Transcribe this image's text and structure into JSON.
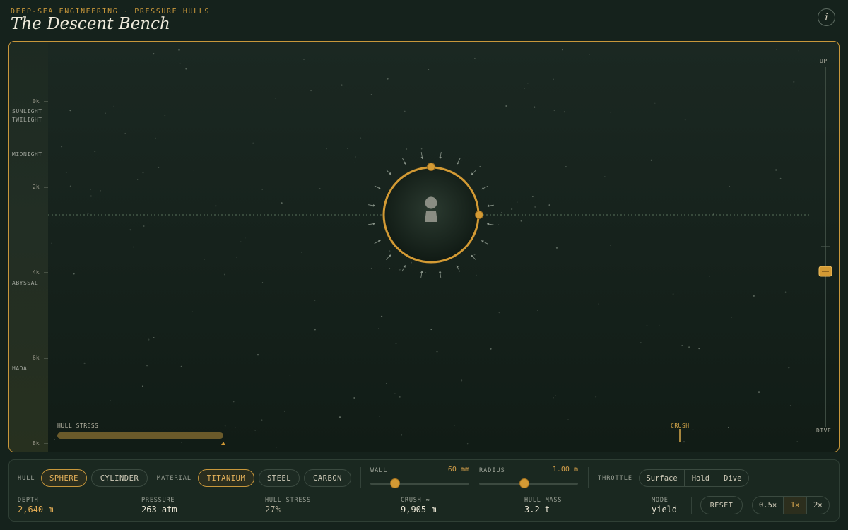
{
  "header": {
    "eyebrow": "DEEP-SEA ENGINEERING · PRESSURE HULLS",
    "title": "The Descent Bench",
    "info_icon": "info-icon"
  },
  "gauge": {
    "ticks": [
      "0k",
      "2k",
      "4k",
      "6k",
      "8k"
    ],
    "zones": [
      "SUNLIGHT",
      "TWILIGHT",
      "MIDNIGHT",
      "ABYSSAL",
      "HADAL"
    ],
    "current_depth_m": 2640,
    "max_depth_m": 8000
  },
  "throttle_slider": {
    "top_label": "UP",
    "bottom_label": "DIVE",
    "level": 0.48
  },
  "stage": {
    "hull_stress_label": "HULL STRESS",
    "hull_stress_fraction": 0.27,
    "crush_label": "CRUSH",
    "crush_depth_m": 9905
  },
  "controls": {
    "hull_label": "HULL",
    "hull_options": [
      "SPHERE",
      "CYLINDER"
    ],
    "hull_selected": "SPHERE",
    "material_label": "MATERIAL",
    "material_options": [
      "TITANIUM",
      "STEEL",
      "CARBON"
    ],
    "material_selected": "TITANIUM",
    "wall_label": "WALL",
    "wall_value": "60",
    "wall_unit": "mm",
    "wall_level": 0.25,
    "radius_label": "RADIUS",
    "radius_value": "1.00",
    "radius_unit": "m",
    "radius_level": 0.46,
    "throttle_label": "THROTTLE",
    "throttle_options": [
      "Surface",
      "Hold",
      "Dive"
    ]
  },
  "stats": {
    "depth_label": "DEPTH",
    "depth_value": "2,640 m",
    "pressure_label": "PRESSURE",
    "pressure_value": "263 atm",
    "hull_stress_label": "HULL STRESS",
    "hull_stress_value": "27%",
    "crush_label": "CRUSH ≈",
    "crush_value": "9,905 m",
    "hull_mass_label": "HULL MASS",
    "hull_mass_value": "3.2 t",
    "mode_label": "MODE",
    "mode_value": "yield"
  },
  "actions": {
    "reset_label": "RESET",
    "speed_options": [
      "0.5×",
      "1×",
      "2×"
    ],
    "speed_selected": "1×"
  },
  "colors": {
    "accent": "#c8973b",
    "background": "#15221c",
    "stage_border": "#c8973b"
  }
}
